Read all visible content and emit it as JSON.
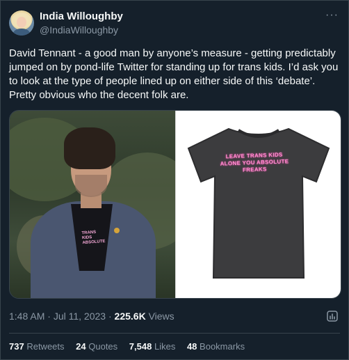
{
  "author": {
    "display_name": "India Willoughby",
    "handle": "@IndiaWilloughby",
    "more_icon": "more-horizontal-icon"
  },
  "tweet": {
    "text": "David Tennant - a good man by anyone’s measure - getting predictably jumped on by pond-life Twitter for standing up for trans kids. I’d ask you to look at the type of people lined up on either side of this ‘debate’. Pretty obvious who the decent folk are."
  },
  "media": {
    "left_shirt_text": "TRANS KIDS ABSOLUTE",
    "right_shirt_text": "LEAVE TRANS KIDS ALONE YOU ABSOLUTE FREAKS"
  },
  "meta": {
    "time": "1:48 AM",
    "sep1": " · ",
    "date": "Jul 11, 2023",
    "sep2": " · ",
    "views_count": "225.6K",
    "views_label": " Views",
    "analytics_icon": "analytics-icon"
  },
  "stats": {
    "retweets_count": "737",
    "retweets_label": "Retweets",
    "quotes_count": "24",
    "quotes_label": "Quotes",
    "likes_count": "7,548",
    "likes_label": "Likes",
    "bookmarks_count": "48",
    "bookmarks_label": "Bookmarks"
  },
  "colors": {
    "background": "#15202b",
    "text_primary": "#f7f9f9",
    "text_secondary": "#8b98a5",
    "border": "#38444d",
    "shirt_print": "#ff8fd1"
  }
}
